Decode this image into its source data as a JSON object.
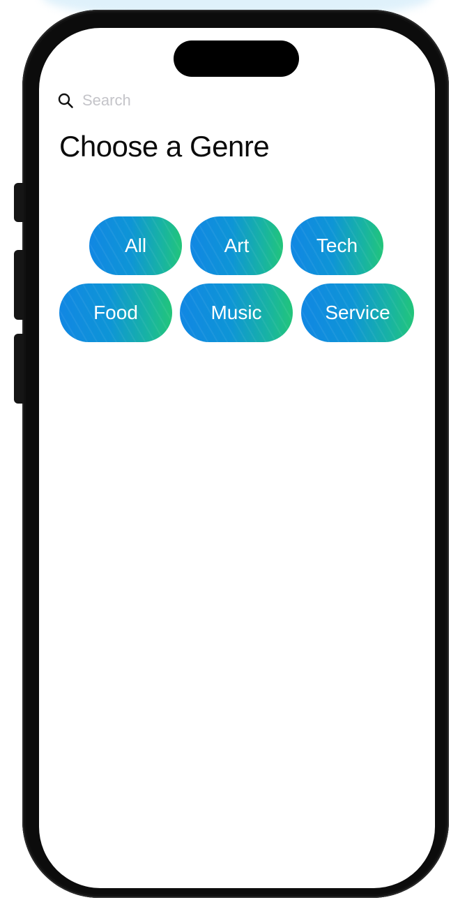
{
  "search": {
    "placeholder": "Search",
    "value": ""
  },
  "page": {
    "title": "Choose a Genre"
  },
  "genres": [
    {
      "label": "All"
    },
    {
      "label": "Art"
    },
    {
      "label": "Tech"
    },
    {
      "label": "Food"
    },
    {
      "label": "Music"
    },
    {
      "label": "Service"
    }
  ],
  "icons": {
    "search": "search-icon"
  },
  "colors": {
    "chip_gradient_start": "#1187e3",
    "chip_gradient_end": "#22c57a",
    "chip_text": "#ffffff",
    "title_text": "#0b0b0b",
    "placeholder_text": "#c4c4c9"
  }
}
